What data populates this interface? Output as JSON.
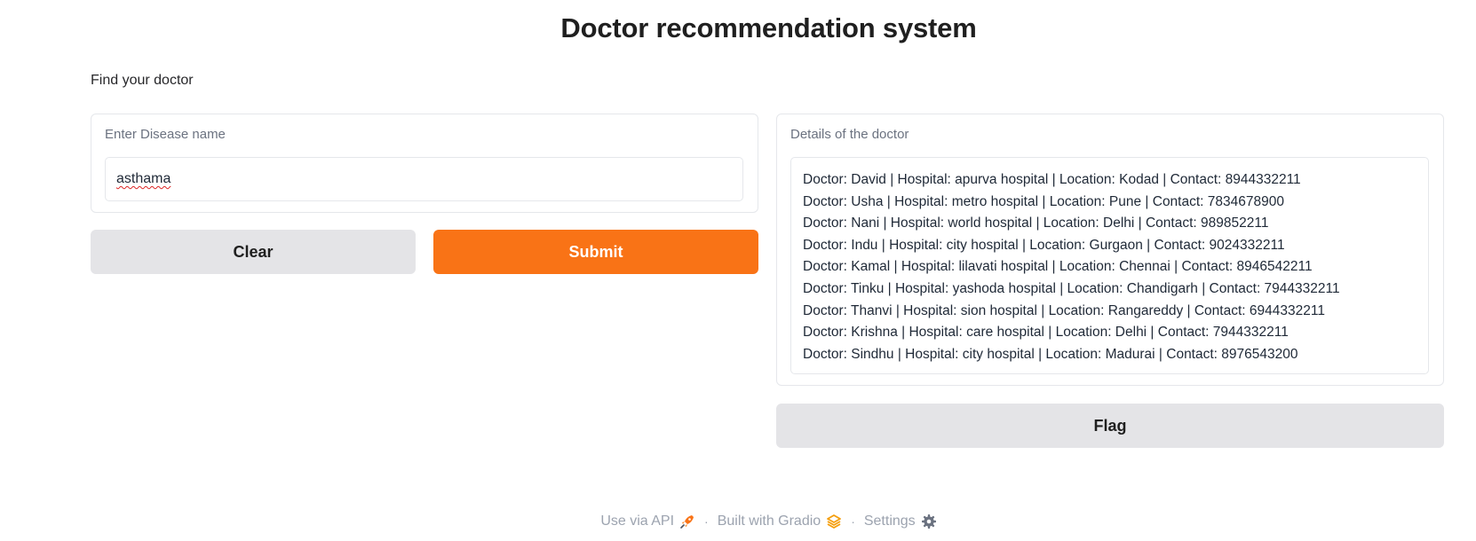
{
  "app": {
    "title": "Doctor recommendation system",
    "description": "Find your doctor"
  },
  "input": {
    "label": "Enter Disease name",
    "value": "asthama"
  },
  "buttons": {
    "clear": "Clear",
    "submit": "Submit",
    "flag": "Flag"
  },
  "output": {
    "label": "Details of the doctor",
    "lines": [
      "Doctor: David | Hospital: apurva hospital | Location: Kodad | Contact: 8944332211",
      "Doctor: Usha | Hospital: metro hospital | Location: Pune | Contact: 7834678900",
      "Doctor: Nani | Hospital: world hospital | Location: Delhi | Contact: 989852211",
      "Doctor: Indu | Hospital: city hospital | Location: Gurgaon | Contact: 9024332211",
      "Doctor: Kamal | Hospital: lilavati hospital | Location: Chennai | Contact: 8946542211",
      "Doctor: Tinku | Hospital: yashoda hospital | Location: Chandigarh | Contact: 7944332211",
      "Doctor: Thanvi | Hospital: sion hospital | Location: Rangareddy | Contact: 6944332211",
      "Doctor: Krishna | Hospital: care hospital | Location: Delhi | Contact: 7944332211",
      "Doctor: Sindhu | Hospital: city hospital | Location: Madurai | Contact: 8976543200"
    ]
  },
  "footer": {
    "api": "Use via API",
    "api_icon": "rocket-icon",
    "built": "Built with Gradio",
    "built_icon": "gradio-logo-icon",
    "settings": "Settings",
    "settings_icon": "gear-icon",
    "separator": "·"
  },
  "colors": {
    "primary": "#f97316",
    "secondary": "#e4e4e7"
  }
}
